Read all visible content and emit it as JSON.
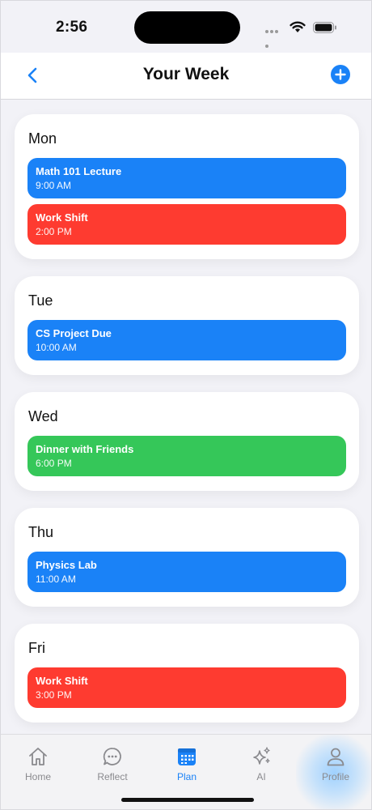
{
  "status_bar": {
    "time": "2:56"
  },
  "nav": {
    "title": "Your Week"
  },
  "days": [
    {
      "label": "Mon",
      "events": [
        {
          "title": "Math 101 Lecture",
          "time": "9:00 AM",
          "color": "#1a82f7"
        },
        {
          "title": "Work Shift",
          "time": "2:00 PM",
          "color": "#fe3b30"
        }
      ]
    },
    {
      "label": "Tue",
      "events": [
        {
          "title": "CS Project Due",
          "time": "10:00 AM",
          "color": "#1a82f7"
        }
      ]
    },
    {
      "label": "Wed",
      "events": [
        {
          "title": "Dinner with Friends",
          "time": "6:00 PM",
          "color": "#35c759"
        }
      ]
    },
    {
      "label": "Thu",
      "events": [
        {
          "title": "Physics Lab",
          "time": "11:00 AM",
          "color": "#1a82f7"
        }
      ]
    },
    {
      "label": "Fri",
      "events": [
        {
          "title": "Work Shift",
          "time": "3:00 PM",
          "color": "#fe3b30"
        }
      ]
    }
  ],
  "tabs": [
    {
      "label": "Home",
      "icon": "home-icon"
    },
    {
      "label": "Reflect",
      "icon": "chat-bubble-icon"
    },
    {
      "label": "Plan",
      "icon": "calendar-icon",
      "active": true
    },
    {
      "label": "AI",
      "icon": "sparkles-icon"
    },
    {
      "label": "Profile",
      "icon": "person-icon"
    }
  ],
  "colors": {
    "accent": "#1a82f7",
    "red": "#fe3b30",
    "green": "#35c759"
  }
}
